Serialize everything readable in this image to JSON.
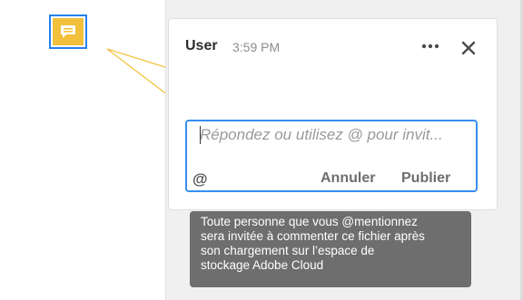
{
  "comment": {
    "author": "User",
    "time": "3:59 PM",
    "more_icon": "more-horizontal-icon",
    "close_icon": "close-icon"
  },
  "reply": {
    "placeholder": "Répondez ou utilisez @ pour invit...",
    "mention_label": "@",
    "cancel_label": "Annuler",
    "publish_label": "Publier"
  },
  "tooltip": {
    "lines": [
      "Toute personne que vous @mentionnez",
      "sera invitée à commenter ce fichier après",
      "son chargement sur l’espace de",
      "stockage Adobe Cloud"
    ]
  },
  "annotation": {
    "icon": "sticky-note-icon",
    "color": "#f2c03a",
    "selection_color": "#2680eb"
  }
}
